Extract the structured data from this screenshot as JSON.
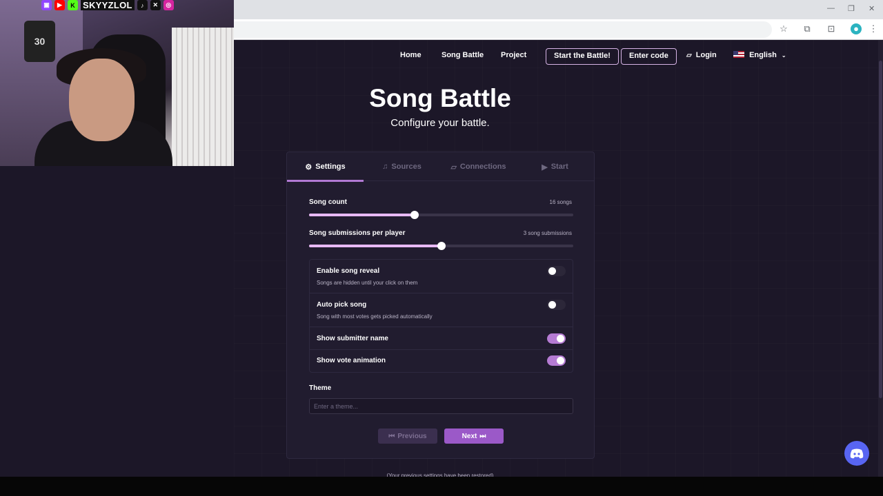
{
  "stream_overlay": {
    "handle": "SKYYZLOL",
    "jersey_number": "30",
    "socials": [
      "twitch-icon",
      "youtube-icon",
      "kick-icon",
      "tiktok-icon",
      "x-icon",
      "instagram-icon"
    ]
  },
  "nav": {
    "home": "Home",
    "song_battle": "Song Battle",
    "project": "Project",
    "start_battle": "Start the Battle!",
    "enter_code": "Enter code",
    "login": "Login",
    "language": "English"
  },
  "header": {
    "title": "Song Battle",
    "subtitle": "Configure your battle."
  },
  "tabs": [
    {
      "label": "Settings",
      "icon": "gear-icon",
      "active": true
    },
    {
      "label": "Sources",
      "icon": "music-note-icon",
      "active": false
    },
    {
      "label": "Connections",
      "icon": "twitch-icon",
      "active": false
    },
    {
      "label": "Start",
      "icon": "play-icon",
      "active": false
    }
  ],
  "settings": {
    "song_count": {
      "label": "Song count",
      "value_text": "16 songs",
      "fraction": 0.4
    },
    "submissions": {
      "label": "Song submissions per player",
      "value_text": "3 song submissions",
      "fraction": 0.5
    },
    "options": [
      {
        "title": "Enable song reveal",
        "desc": "Songs are hidden until your click on them",
        "on": false
      },
      {
        "title": "Auto pick song",
        "desc": "Song with most votes gets picked automatically",
        "on": false
      },
      {
        "title": "Show submitter name",
        "desc": "",
        "on": true
      },
      {
        "title": "Show vote animation",
        "desc": "",
        "on": true
      }
    ],
    "theme": {
      "label": "Theme",
      "placeholder": "Enter a theme..."
    }
  },
  "buttons": {
    "previous": "Previous",
    "next": "Next"
  },
  "footer_note": "(Your previous settings have been restored)",
  "colors": {
    "accent": "#9b59c8",
    "background": "#1c1728",
    "card": "#211c2f",
    "discord": "#5865f2"
  }
}
